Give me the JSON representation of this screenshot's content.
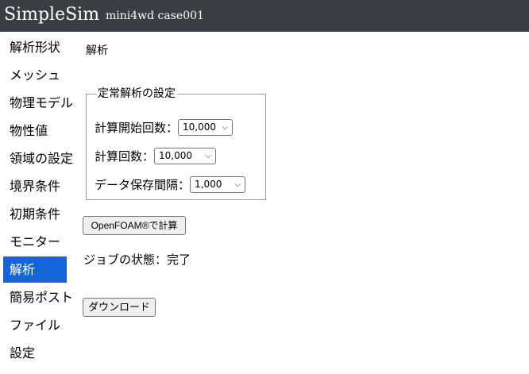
{
  "header": {
    "app_title": "SimpleSim",
    "case_name": "mini4wd case001"
  },
  "sidebar": {
    "items": [
      {
        "label": "解析形状"
      },
      {
        "label": "メッシュ"
      },
      {
        "label": "物理モデル"
      },
      {
        "label": "物性値"
      },
      {
        "label": "領域の設定"
      },
      {
        "label": "境界条件"
      },
      {
        "label": "初期条件"
      },
      {
        "label": "モニター"
      },
      {
        "label": "解析"
      },
      {
        "label": "簡易ポスト"
      },
      {
        "label": "ファイル"
      },
      {
        "label": "設定"
      }
    ],
    "active_index": 8,
    "active_color": "#1565d8"
  },
  "main": {
    "section_title": "解析",
    "steady_settings": {
      "legend": "定常解析の設定",
      "start_iteration_label": "計算開始回数：",
      "start_iteration_value": "10,000",
      "iterations_label": "計算回数：",
      "iterations_value": "10,000",
      "save_interval_label": "データ保存間隔：",
      "save_interval_value": "1,000"
    },
    "run_button_label": "OpenFOAM®で計算",
    "job_status_text": "ジョブの状態：完了",
    "download_button_label": "ダウンロード"
  }
}
